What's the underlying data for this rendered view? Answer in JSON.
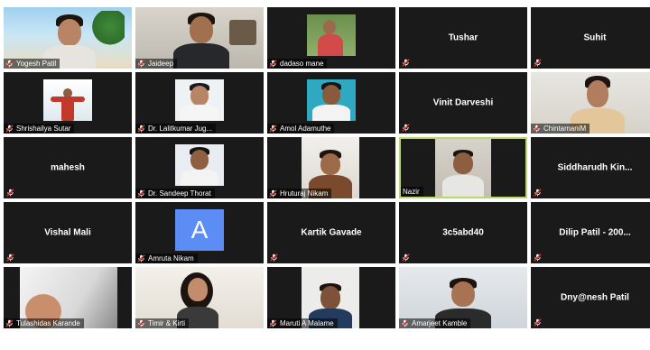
{
  "participants": [
    {
      "name": "Yogesh Patil"
    },
    {
      "name": "Jaideep"
    },
    {
      "name": "dadaso mane"
    },
    {
      "name": "Tushar"
    },
    {
      "name": "Suhit"
    },
    {
      "name": "Shrishailya Sutar"
    },
    {
      "name": "Dr. Lalitkumar Jug..."
    },
    {
      "name": "Amol Adamuthe"
    },
    {
      "name": "Vinit Darveshi"
    },
    {
      "name": "ChintamaniM"
    },
    {
      "name": "mahesh"
    },
    {
      "name": "Dr. Sandeep Thorat"
    },
    {
      "name": "Hruturaj Nikam"
    },
    {
      "name": "Nazir"
    },
    {
      "name": "Siddharudh  Kin..."
    },
    {
      "name": "Vishal Mali"
    },
    {
      "name": "Amruta Nikam",
      "avatar_letter": "A"
    },
    {
      "name": "Kartik Gavade"
    },
    {
      "name": "3c5abd40"
    },
    {
      "name": "Dilip Patil - 200..."
    },
    {
      "name": "Tulashidas Karande"
    },
    {
      "name": "Timir & Kirti"
    },
    {
      "name": "Maruti A Malame"
    },
    {
      "name": "Amarjeet Kamble"
    },
    {
      "name": "Dny@nesh Patil"
    }
  ],
  "icons": {
    "muted": "mic-muted-icon"
  },
  "colors": {
    "muted_icon": "#e0302a",
    "active_speaker_border": "#b7d96a",
    "tile_bg": "#1a1a1a",
    "avatar_bg": "#5b8df5"
  }
}
